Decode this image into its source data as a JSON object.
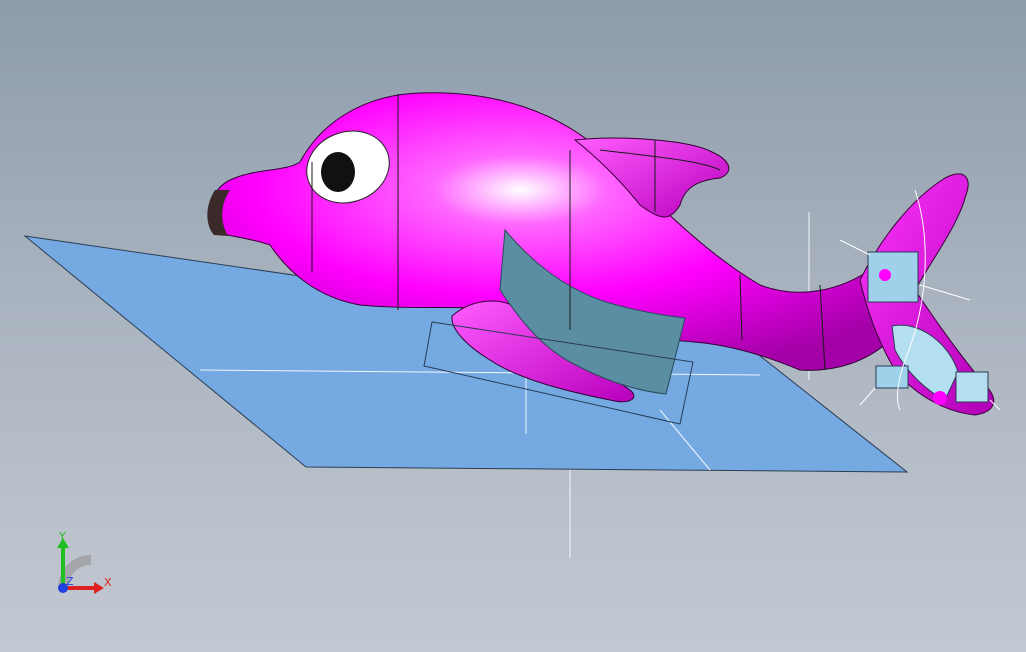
{
  "viewport": {
    "background_top": "#8d9bab",
    "background_bottom": "#c3c9d2"
  },
  "model": {
    "body_color": "#ff00ff",
    "plane_color": "#74a9e1",
    "surface_patch_color": "#5c8ea3",
    "eye_white": "#ffffff",
    "eye_pupil": "#111111"
  },
  "triad": {
    "x_label": "X",
    "y_label": "Y",
    "z_label": "Z",
    "x_color": "#e02020",
    "y_color": "#20c020",
    "z_color": "#2040e0"
  }
}
